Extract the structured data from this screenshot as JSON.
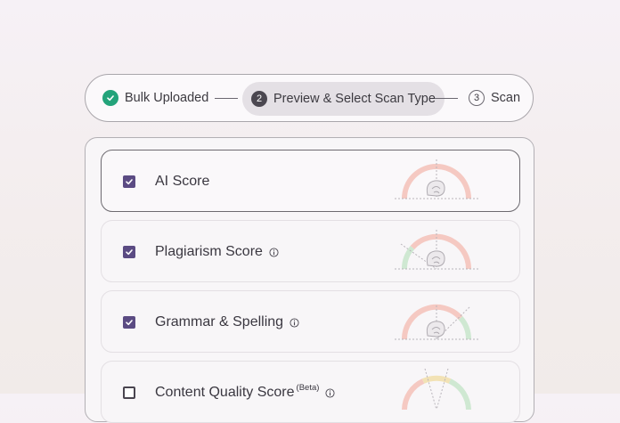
{
  "stepper": {
    "steps": [
      {
        "number": "",
        "label": "Bulk Uploaded",
        "state": "done",
        "icon": "check-icon"
      },
      {
        "number": "2",
        "label": "Preview & Select Scan Type",
        "state": "active"
      },
      {
        "number": "3",
        "label": "Scan",
        "state": "upcoming"
      }
    ]
  },
  "scan_types": [
    {
      "label": "AI Score",
      "checked": true,
      "selected": true,
      "info": false,
      "beta": ""
    },
    {
      "label": "Plagiarism Score",
      "checked": true,
      "selected": false,
      "info": true,
      "beta": ""
    },
    {
      "label": "Grammar & Spelling",
      "checked": true,
      "selected": false,
      "info": true,
      "beta": ""
    },
    {
      "label": "Content Quality Score",
      "checked": false,
      "selected": false,
      "info": true,
      "beta": "(Beta)"
    }
  ],
  "colors": {
    "check_green": "#23a37a",
    "checkbox_purple": "#5b4b83",
    "gauge_red": "#f5c9c2",
    "gauge_yellow": "#f2e2b5",
    "gauge_green": "#cfe8d2"
  }
}
